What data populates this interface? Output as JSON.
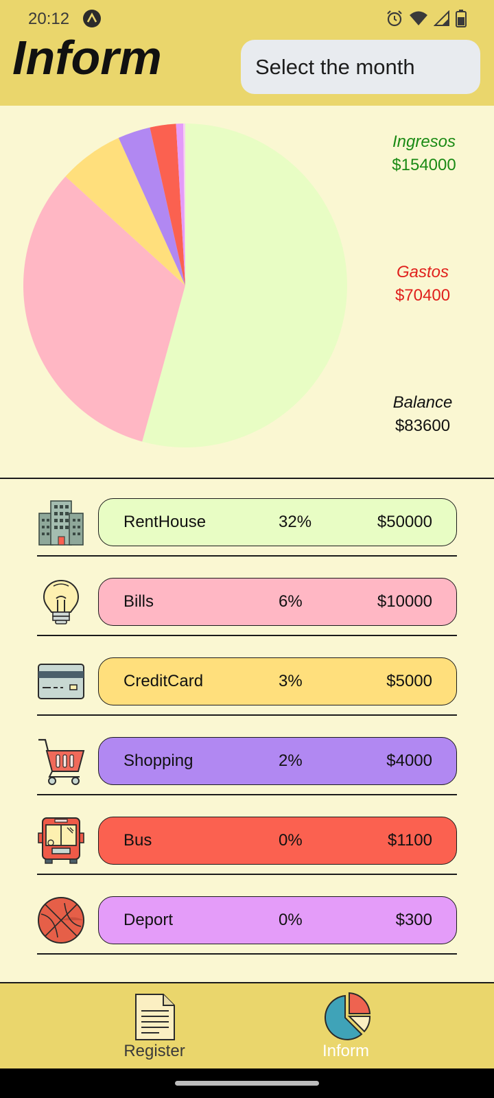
{
  "status_bar": {
    "time": "20:12"
  },
  "header": {
    "title": "Inform",
    "month_button_label": "Select the month"
  },
  "summary": {
    "ingresos_label": "Ingresos",
    "ingresos_value": "$154000",
    "gastos_label": "Gastos",
    "gastos_value": "$70400",
    "balance_label": "Balance",
    "balance_value": "$83600",
    "colors": {
      "ingresos": "#1a8a14",
      "gastos": "#e0201c",
      "balance": "#111111"
    }
  },
  "chart_data": {
    "type": "pie",
    "title": "",
    "series": [
      {
        "values": [
          83600,
          50000,
          10000,
          5000,
          4000,
          1100,
          300
        ]
      }
    ],
    "colors": [
      "#E8FDC4",
      "#FFB7C4",
      "#FFDF7C",
      "#B188F2",
      "#FB6150",
      "#E49CF9",
      "#F7D0F2"
    ]
  },
  "categories": [
    {
      "name": "RentHouse",
      "percent": "32%",
      "amount": "$50000",
      "color": "#E8FDC4",
      "icon": "building-icon"
    },
    {
      "name": "Bills",
      "percent": "6%",
      "amount": "$10000",
      "color": "#FFB7C4",
      "icon": "lightbulb-icon"
    },
    {
      "name": "CreditCard",
      "percent": "3%",
      "amount": "$5000",
      "color": "#FFDF7C",
      "icon": "credit-card-icon"
    },
    {
      "name": "Shopping",
      "percent": "2%",
      "amount": "$4000",
      "color": "#B188F2",
      "icon": "shopping-cart-icon"
    },
    {
      "name": "Bus",
      "percent": "0%",
      "amount": "$1100",
      "color": "#FB6150",
      "icon": "bus-icon"
    },
    {
      "name": "Deport",
      "percent": "0%",
      "amount": "$300",
      "color": "#E49CF9",
      "icon": "basketball-icon"
    }
  ],
  "bottom_nav": {
    "register_label": "Register",
    "inform_label": "Inform"
  }
}
